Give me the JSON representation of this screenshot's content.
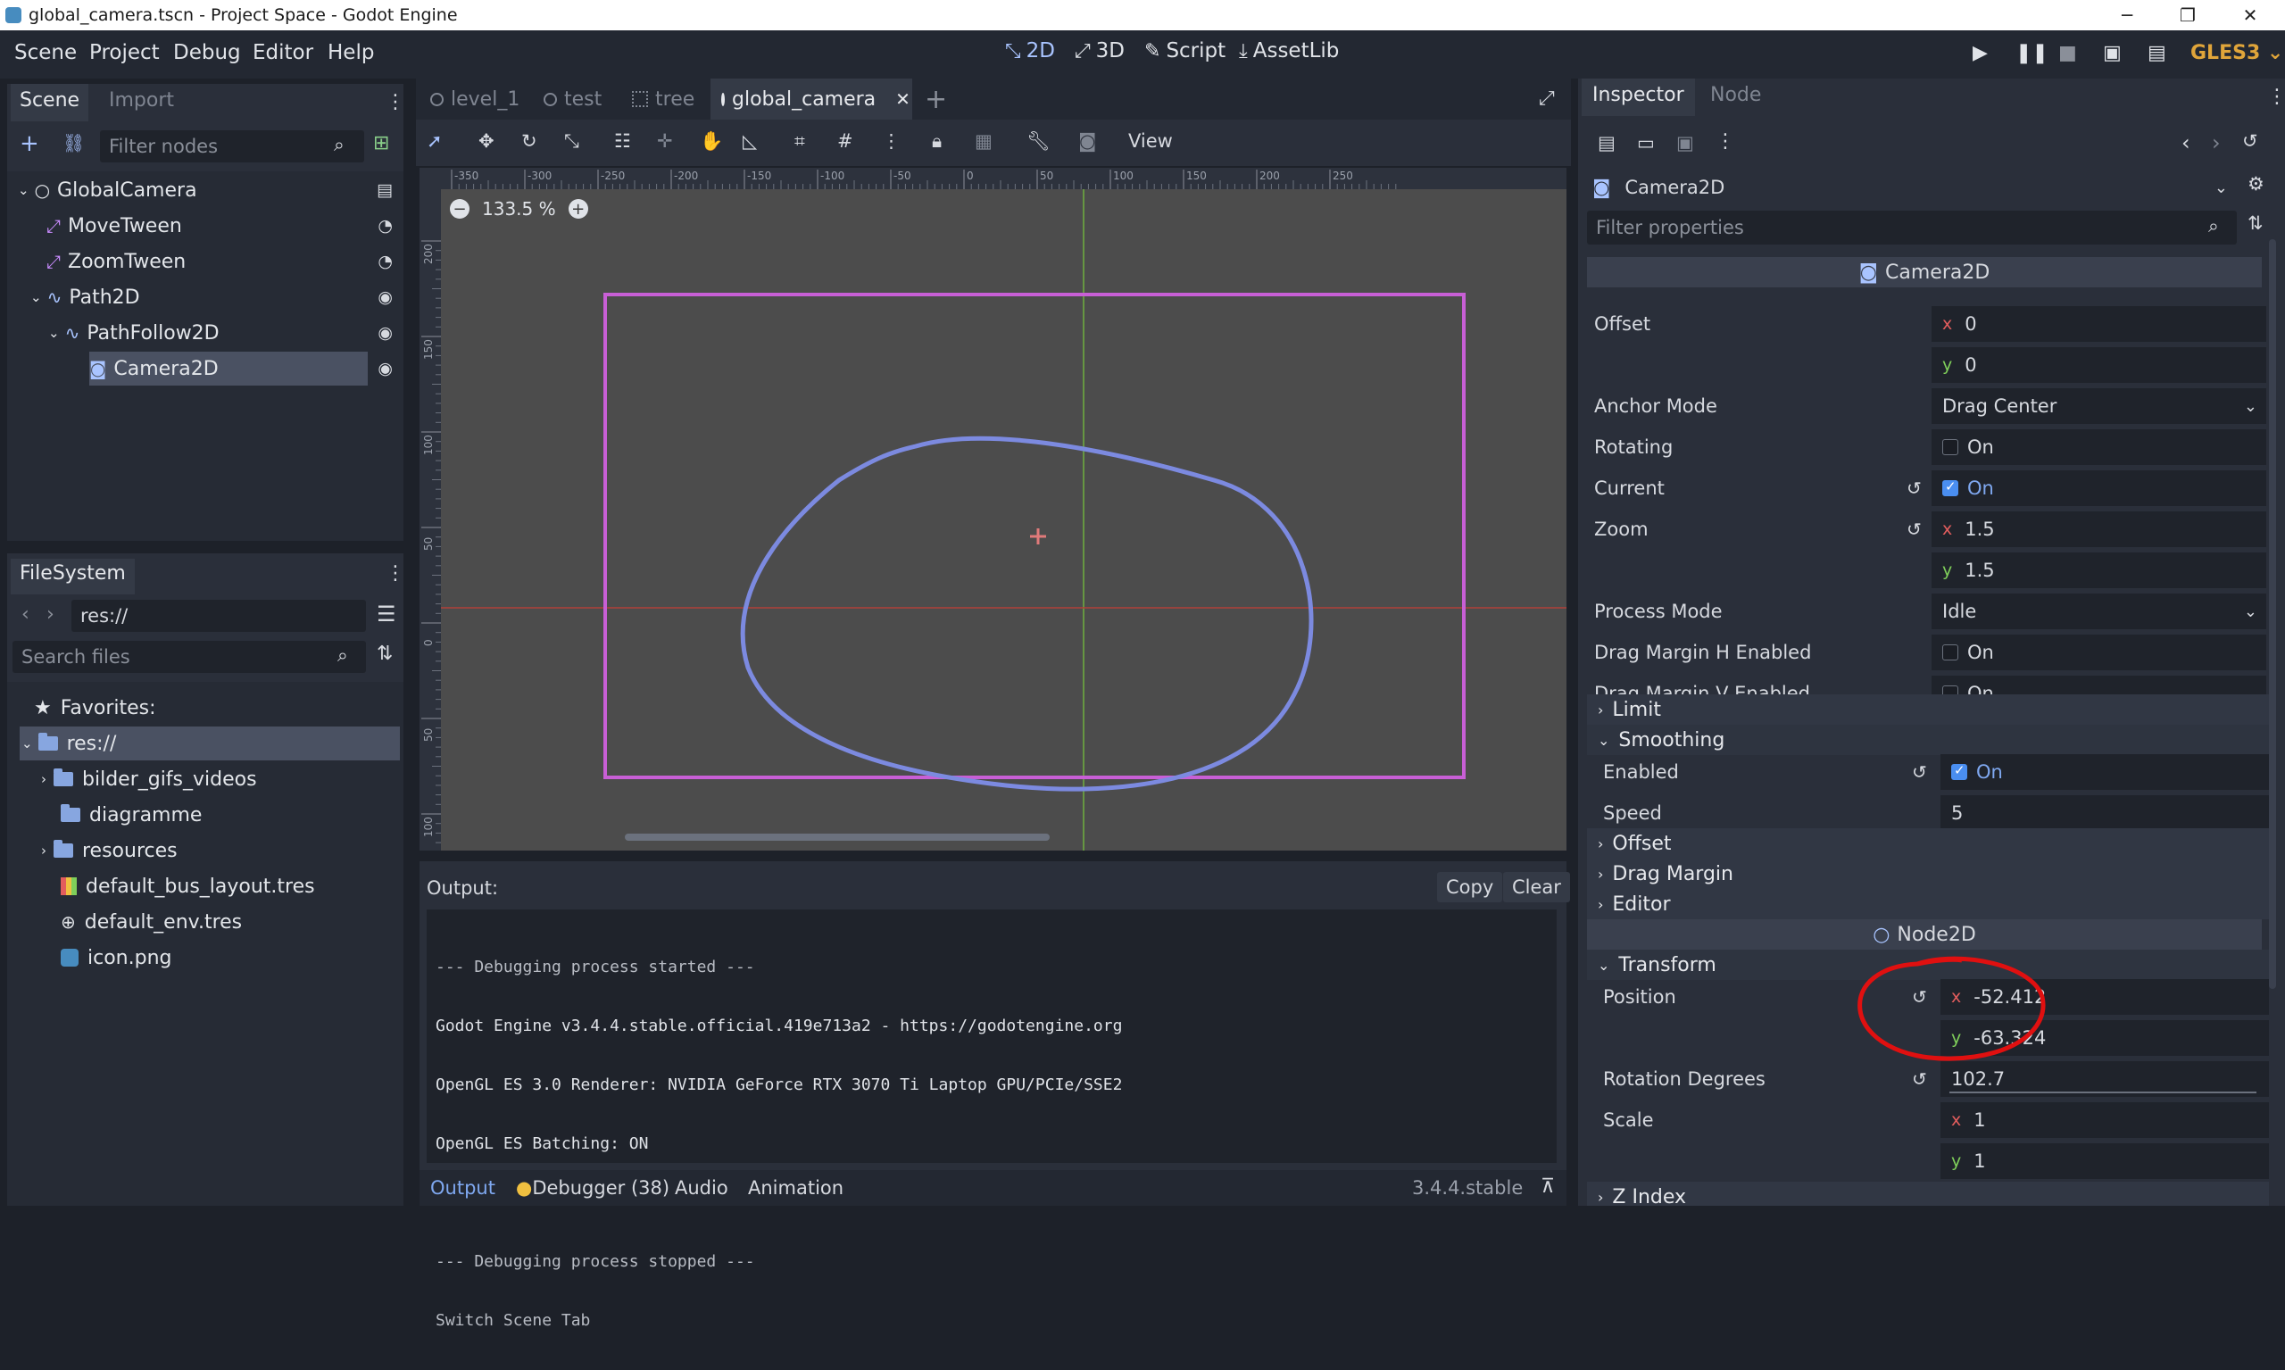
{
  "window": {
    "title": "global_camera.tscn - Project Space - Godot Engine",
    "minimize": "─",
    "maximize": "❐",
    "close": "✕"
  },
  "menubar": {
    "items": [
      "Scene",
      "Project",
      "Debug",
      "Editor",
      "Help"
    ],
    "workspaces": [
      "2D",
      "3D",
      "Script",
      "AssetLib"
    ],
    "renderer": "GLES3"
  },
  "scene_dock": {
    "tabs": [
      "Scene",
      "Import"
    ],
    "filter_placeholder": "Filter nodes",
    "nodes": [
      "GlobalCamera",
      "MoveTween",
      "ZoomTween",
      "Path2D",
      "PathFollow2D",
      "Camera2D"
    ]
  },
  "filesystem": {
    "title": "FileSystem",
    "path": "res://",
    "search_placeholder": "Search files",
    "favorites": "Favorites:",
    "items": [
      "res://",
      "bilder_gifs_videos",
      "diagramme",
      "resources",
      "default_bus_layout.tres",
      "default_env.tres",
      "icon.png"
    ]
  },
  "editor": {
    "tabs": [
      "level_1",
      "test",
      "tree",
      "global_camera"
    ],
    "view_menu": "View",
    "zoom": "133.5 %",
    "ruler_top": [
      "-350",
      "-300",
      "-250",
      "-200",
      "-150",
      "-100",
      "-50",
      "0",
      "50",
      "100",
      "150",
      "200",
      "250"
    ],
    "ruler_left": [
      "200",
      "150",
      "100",
      "50",
      "0",
      "50",
      "100"
    ]
  },
  "output": {
    "label": "Output:",
    "copy": "Copy",
    "clear": "Clear",
    "lines": [
      "--- Debugging process started ---",
      "Godot Engine v3.4.4.stable.official.419e713a2 - https://godotengine.org",
      "OpenGL ES 3.0 Renderer: NVIDIA GeForce RTX 3070 Ti Laptop GPU/PCIe/SSE2",
      "OpenGL ES Batching: ON",
      "",
      "--- Debugging process stopped ---",
      "Switch Scene Tab"
    ],
    "bottom_tabs": [
      "Output",
      "Debugger (38)",
      "Audio",
      "Animation"
    ],
    "version": "3.4.4.stable"
  },
  "inspector": {
    "tabs": [
      "Inspector",
      "Node"
    ],
    "object": "Camera2D",
    "filter_placeholder": "Filter properties",
    "class_header": "Camera2D",
    "offset": {
      "label": "Offset",
      "x": "0",
      "y": "0"
    },
    "anchor_mode": {
      "label": "Anchor Mode",
      "value": "Drag Center"
    },
    "rotating": {
      "label": "Rotating",
      "value": "On"
    },
    "current": {
      "label": "Current",
      "value": "On"
    },
    "zoom": {
      "label": "Zoom",
      "x": "1.5",
      "y": "1.5"
    },
    "process_mode": {
      "label": "Process Mode",
      "value": "Idle"
    },
    "drag_h": {
      "label": "Drag Margin H Enabled",
      "value": "On"
    },
    "drag_v": {
      "label": "Drag Margin V Enabled",
      "value": "On"
    },
    "limit": "Limit",
    "smoothing": "Smoothing",
    "smooth_enabled": {
      "label": "Enabled",
      "value": "On"
    },
    "smooth_speed": {
      "label": "Speed",
      "value": "5"
    },
    "offset_group": "Offset",
    "drag_margin_group": "Drag Margin",
    "editor_group": "Editor",
    "node2d_header": "Node2D",
    "transform": "Transform",
    "position": {
      "label": "Position",
      "x": "-52.412",
      "y": "-63.324"
    },
    "rotation": {
      "label": "Rotation Degrees",
      "value": "102.7"
    },
    "scale": {
      "label": "Scale",
      "x": "1",
      "y": "1"
    },
    "z_index": "Z Index",
    "axis_x": "x",
    "axis_y": "y"
  }
}
